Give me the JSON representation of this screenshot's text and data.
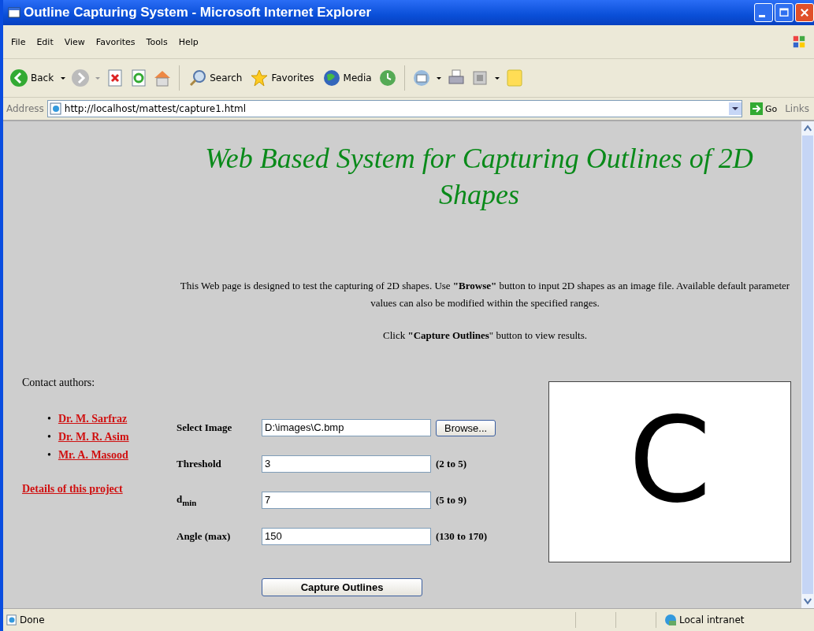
{
  "window": {
    "title": "Outline Capturing System - Microsoft Internet Explorer"
  },
  "menu": [
    "File",
    "Edit",
    "View",
    "Favorites",
    "Tools",
    "Help"
  ],
  "toolbar": {
    "back": "Back",
    "search": "Search",
    "favorites": "Favorites",
    "media": "Media"
  },
  "address_bar": {
    "label": "Address",
    "url": "http://localhost/mattest/capture1.html",
    "go": "Go",
    "links": "Links"
  },
  "page": {
    "heading": "Web Based  System for Capturing Outlines of 2D Shapes",
    "intro": "This Web page is designed to test the capturing of 2D shapes. Use **\"Browse\"** button to input 2D shapes as an image file. Available default parameter values can also be modified within the specified ranges.",
    "instruction": "Click **\"Capture Outlines**\" button to view results.",
    "contact_heading": "Contact authors:",
    "authors": [
      {
        "marker": "•",
        "name": "Dr. M. Sarfraz"
      },
      {
        "marker": "•",
        "name": "Dr. M. R. Asim"
      },
      {
        "marker": "•",
        "name": "Mr. A. Masood"
      }
    ],
    "details_link": "Details of this project",
    "form": [
      {
        "kind": "file",
        "label": "Select Image",
        "value": "D:\\images\\C.bmp",
        "button": "Browse..."
      },
      {
        "kind": "number",
        "label": "Threshold",
        "value": "3",
        "range": "(2 to 5)"
      },
      {
        "kind": "number",
        "label": "d$_{min}$",
        "value": "7",
        "range": "(5 to 9)"
      },
      {
        "kind": "number",
        "label": "Angle (max)",
        "value": "150",
        "range": "(130 to 170)"
      }
    ],
    "submit": "Capture Outlines",
    "preview": {
      "letter": "C"
    }
  },
  "status_bar": {
    "text": "Done",
    "zone": "Local intranet"
  }
}
